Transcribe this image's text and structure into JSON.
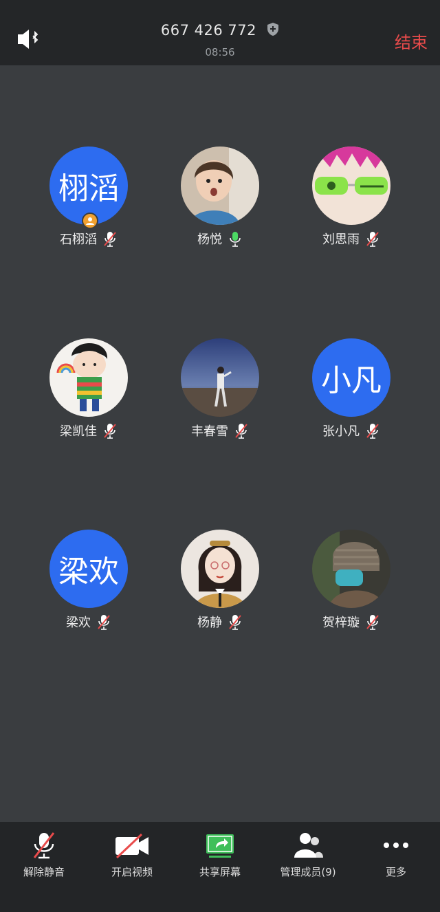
{
  "header": {
    "meeting_id": "667 426 772",
    "timer": "08:56",
    "end_label": "结束"
  },
  "members": [
    {
      "name": "石栩滔",
      "avatar_text": "栩滔",
      "mic": "muted",
      "host": true
    },
    {
      "name": "杨悦",
      "avatar_text": "",
      "mic": "active"
    },
    {
      "name": "刘思雨",
      "avatar_text": "",
      "mic": "muted"
    },
    {
      "name": "梁凯佳",
      "avatar_text": "",
      "mic": "muted"
    },
    {
      "name": "丰春雪",
      "avatar_text": "",
      "mic": "muted"
    },
    {
      "name": "张小凡",
      "avatar_text": "小凡",
      "mic": "muted"
    },
    {
      "name": "梁欢",
      "avatar_text": "梁欢",
      "mic": "muted"
    },
    {
      "name": "杨静",
      "avatar_text": "",
      "mic": "muted"
    },
    {
      "name": "贺梓璇",
      "avatar_text": "",
      "mic": "muted"
    }
  ],
  "toolbar": {
    "unmute": "解除静音",
    "video": "开启视频",
    "share": "共享屏幕",
    "members": "管理成员(9)",
    "more": "更多"
  },
  "colors": {
    "avatar_blue": "#2d6cf0",
    "end_red": "#e94b4b",
    "mic_active": "#4cd964",
    "share_green": "#3fbf5a"
  }
}
